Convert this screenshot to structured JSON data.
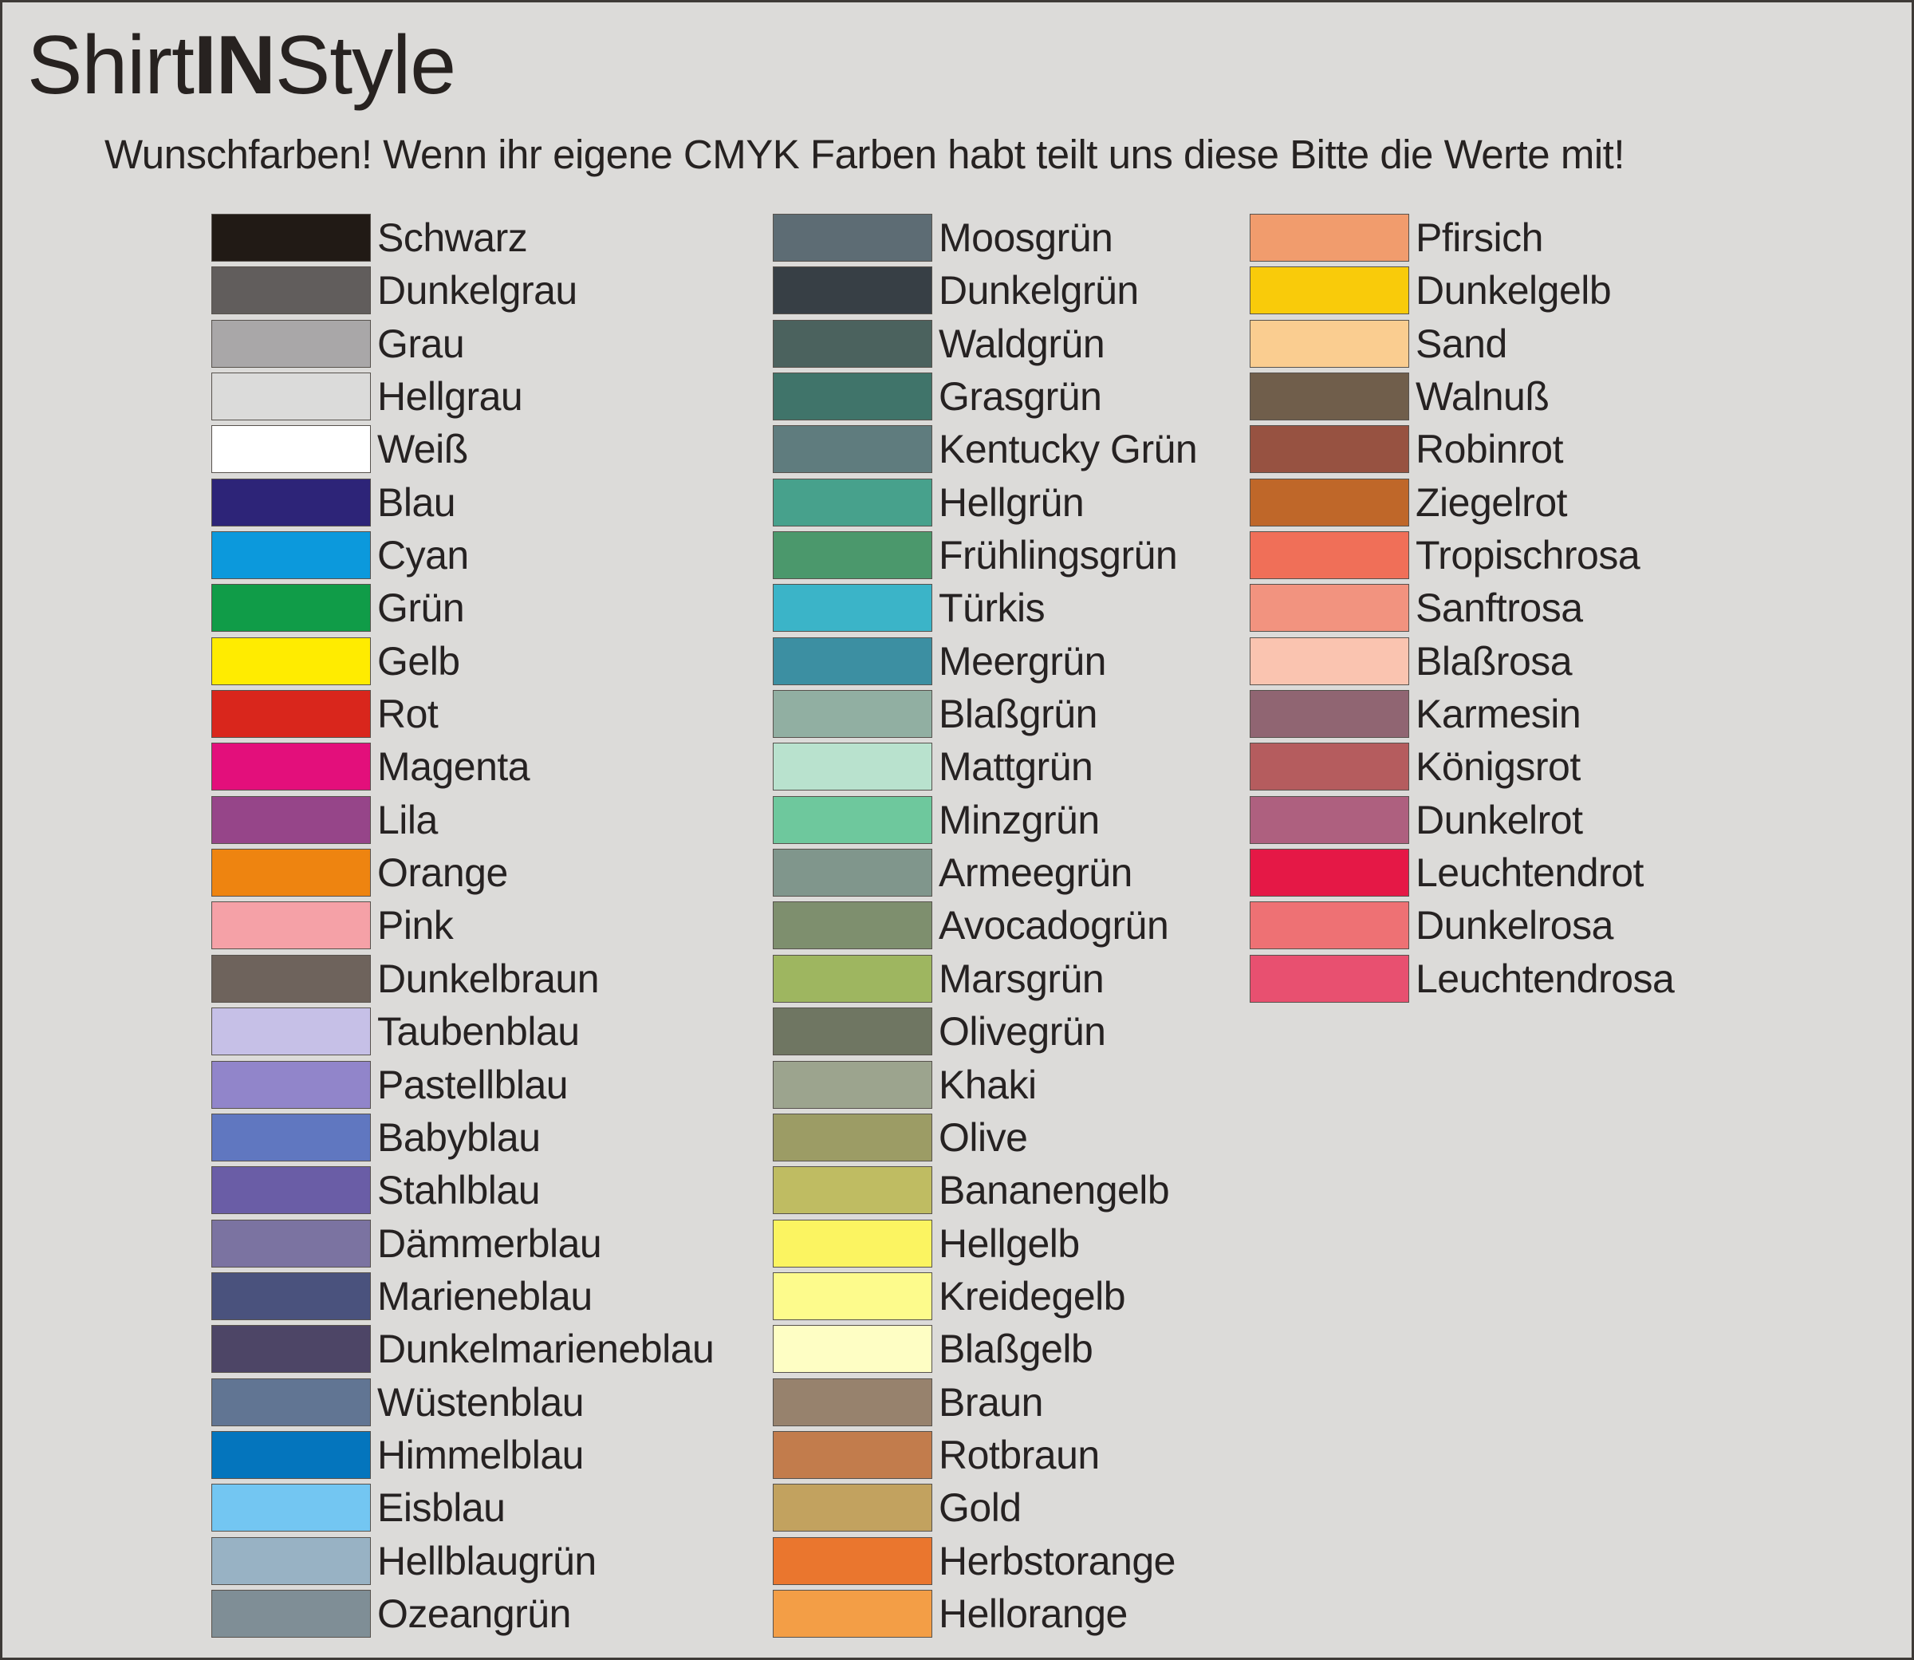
{
  "page": {
    "title_parts": {
      "left": "Shirt",
      "mid": "IN",
      "right": "Style"
    },
    "subtitle": "Wunschfarben! Wenn ihr eigene CMYK Farben habt teilt uns diese Bitte die Werte mit!",
    "background": "#dcdbd9",
    "frame_color": "#3e3a37",
    "swatch_border_color": "#57524d"
  },
  "columns": [
    {
      "id": "column-1",
      "swatches": [
        {
          "name": "Schwarz",
          "color": "#211a15"
        },
        {
          "name": "Dunkelgrau",
          "color": "#615d5c"
        },
        {
          "name": "Grau",
          "color": "#a9a7a8"
        },
        {
          "name": "Hellgrau",
          "color": "#dbdbda"
        },
        {
          "name": "Weiß",
          "color": "#ffffff"
        },
        {
          "name": "Blau",
          "color": "#2d2478"
        },
        {
          "name": "Cyan",
          "color": "#0c99dc"
        },
        {
          "name": "Grün",
          "color": "#109c48"
        },
        {
          "name": "Gelb",
          "color": "#ffec00"
        },
        {
          "name": "Rot",
          "color": "#d9261c"
        },
        {
          "name": "Magenta",
          "color": "#e30f7b"
        },
        {
          "name": "Lila",
          "color": "#964589"
        },
        {
          "name": "Orange",
          "color": "#ee8410"
        },
        {
          "name": "Pink",
          "color": "#f5a1a7"
        },
        {
          "name": "Dunkelbraun",
          "color": "#6e635c"
        },
        {
          "name": "Taubenblau",
          "color": "#c6c0e7"
        },
        {
          "name": "Pastellblau",
          "color": "#9185ca"
        },
        {
          "name": "Babyblau",
          "color": "#6077c0"
        },
        {
          "name": "Stahlblau",
          "color": "#6a5da6"
        },
        {
          "name": "Dämmerblau",
          "color": "#7b73a1"
        },
        {
          "name": "Marieneblau",
          "color": "#4a527d"
        },
        {
          "name": "Dunkelmarieneblau",
          "color": "#4d4566"
        },
        {
          "name": "Wüstenblau",
          "color": "#617593"
        },
        {
          "name": "Himmelblau",
          "color": "#0475bd"
        },
        {
          "name": "Eisblau",
          "color": "#73c6f2"
        },
        {
          "name": "Hellblaugrün",
          "color": "#98b2c4"
        },
        {
          "name": "Ozeangrün",
          "color": "#7f8e96"
        }
      ]
    },
    {
      "id": "column-2",
      "swatches": [
        {
          "name": "Moosgrün",
          "color": "#5d6c74"
        },
        {
          "name": "Dunkelgrün",
          "color": "#373f45"
        },
        {
          "name": "Waldgrün",
          "color": "#4b625e"
        },
        {
          "name": "Grasgrün",
          "color": "#40746a"
        },
        {
          "name": "Kentucky Grün",
          "color": "#5f7c7e"
        },
        {
          "name": "Hellgrün",
          "color": "#47a18c"
        },
        {
          "name": "Frühlingsgrün",
          "color": "#4b986c"
        },
        {
          "name": "Türkis",
          "color": "#3bb4c8"
        },
        {
          "name": "Meergrün",
          "color": "#3c8fa2"
        },
        {
          "name": "Blaßgrün",
          "color": "#91afa2"
        },
        {
          "name": "Mattgrün",
          "color": "#b9e2ce"
        },
        {
          "name": "Minzgrün",
          "color": "#6ec89d"
        },
        {
          "name": "Armeegrün",
          "color": "#80968c"
        },
        {
          "name": "Avocadogrün",
          "color": "#7e8f6e"
        },
        {
          "name": "Marsgrün",
          "color": "#9eb660"
        },
        {
          "name": "Olivegrün",
          "color": "#6f7662"
        },
        {
          "name": "Khaki",
          "color": "#9ca48e"
        },
        {
          "name": "Olive",
          "color": "#9c9c65"
        },
        {
          "name": "Bananengelb",
          "color": "#bfbc62"
        },
        {
          "name": "Hellgelb",
          "color": "#fbf461"
        },
        {
          "name": "Kreidegelb",
          "color": "#fdfb8c"
        },
        {
          "name": "Blaßgelb",
          "color": "#fefec4"
        },
        {
          "name": "Braun",
          "color": "#97826d"
        },
        {
          "name": "Rotbraun",
          "color": "#c27c4c"
        },
        {
          "name": "Gold",
          "color": "#c2a25f"
        },
        {
          "name": "Herbstorange",
          "color": "#ea762e"
        },
        {
          "name": "Hellorange",
          "color": "#f39e46"
        }
      ]
    },
    {
      "id": "column-3",
      "swatches": [
        {
          "name": "Pfirsich",
          "color": "#f19c6d"
        },
        {
          "name": "Dunkelgelb",
          "color": "#f9cb0a"
        },
        {
          "name": "Sand",
          "color": "#facd90"
        },
        {
          "name": "Walnuß",
          "color": "#705e4b"
        },
        {
          "name": "Robinrot",
          "color": "#975241"
        },
        {
          "name": "Ziegelrot",
          "color": "#bf6729"
        },
        {
          "name": "Tropischrosa",
          "color": "#f06f58"
        },
        {
          "name": "Sanftrosa",
          "color": "#f2937f"
        },
        {
          "name": "Blaßrosa",
          "color": "#fac4b0"
        },
        {
          "name": "Karmesin",
          "color": "#906572"
        },
        {
          "name": "Königsrot",
          "color": "#b55c5e"
        },
        {
          "name": "Dunkelrot",
          "color": "#ae607f"
        },
        {
          "name": "Leuchtendrot",
          "color": "#e51846"
        },
        {
          "name": "Dunkelrosa",
          "color": "#ee7174"
        },
        {
          "name": "Leuchtendrosa",
          "color": "#e85070"
        }
      ]
    }
  ]
}
